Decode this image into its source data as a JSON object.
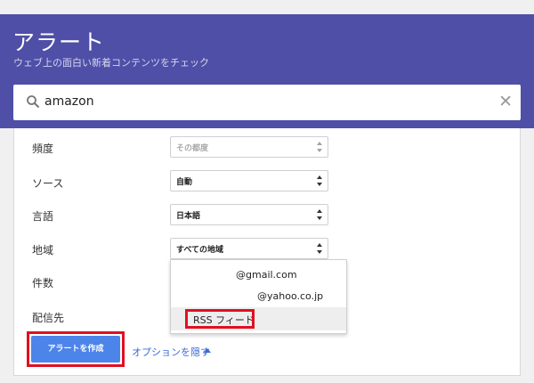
{
  "header": {
    "title": "アラート",
    "subtitle": "ウェブ上の面白い新着コンテンツをチェック"
  },
  "search": {
    "query": "amazon",
    "icon": "search-icon",
    "clear_icon": "close-icon"
  },
  "settings": {
    "frequency": {
      "label": "頻度",
      "value": "その都度",
      "disabled": true
    },
    "source": {
      "label": "ソース",
      "value": "自動"
    },
    "language": {
      "label": "言語",
      "value": "日本語"
    },
    "region": {
      "label": "地域",
      "value": "すべての地域"
    },
    "count": {
      "label": "件数"
    },
    "delivery": {
      "label": "配信先"
    }
  },
  "delivery_dropdown": {
    "options": [
      "@gmail.com",
      "@yahoo.co.jp",
      "RSS フィード"
    ],
    "selected_index": 2
  },
  "actions": {
    "create_label": "アラートを作成",
    "options_label": "オプションを隠す"
  },
  "colors": {
    "header_bg": "#4f4fa8",
    "button_bg": "#4d84ea",
    "link": "#3a6ad5",
    "highlight_outline": "#e01020"
  }
}
